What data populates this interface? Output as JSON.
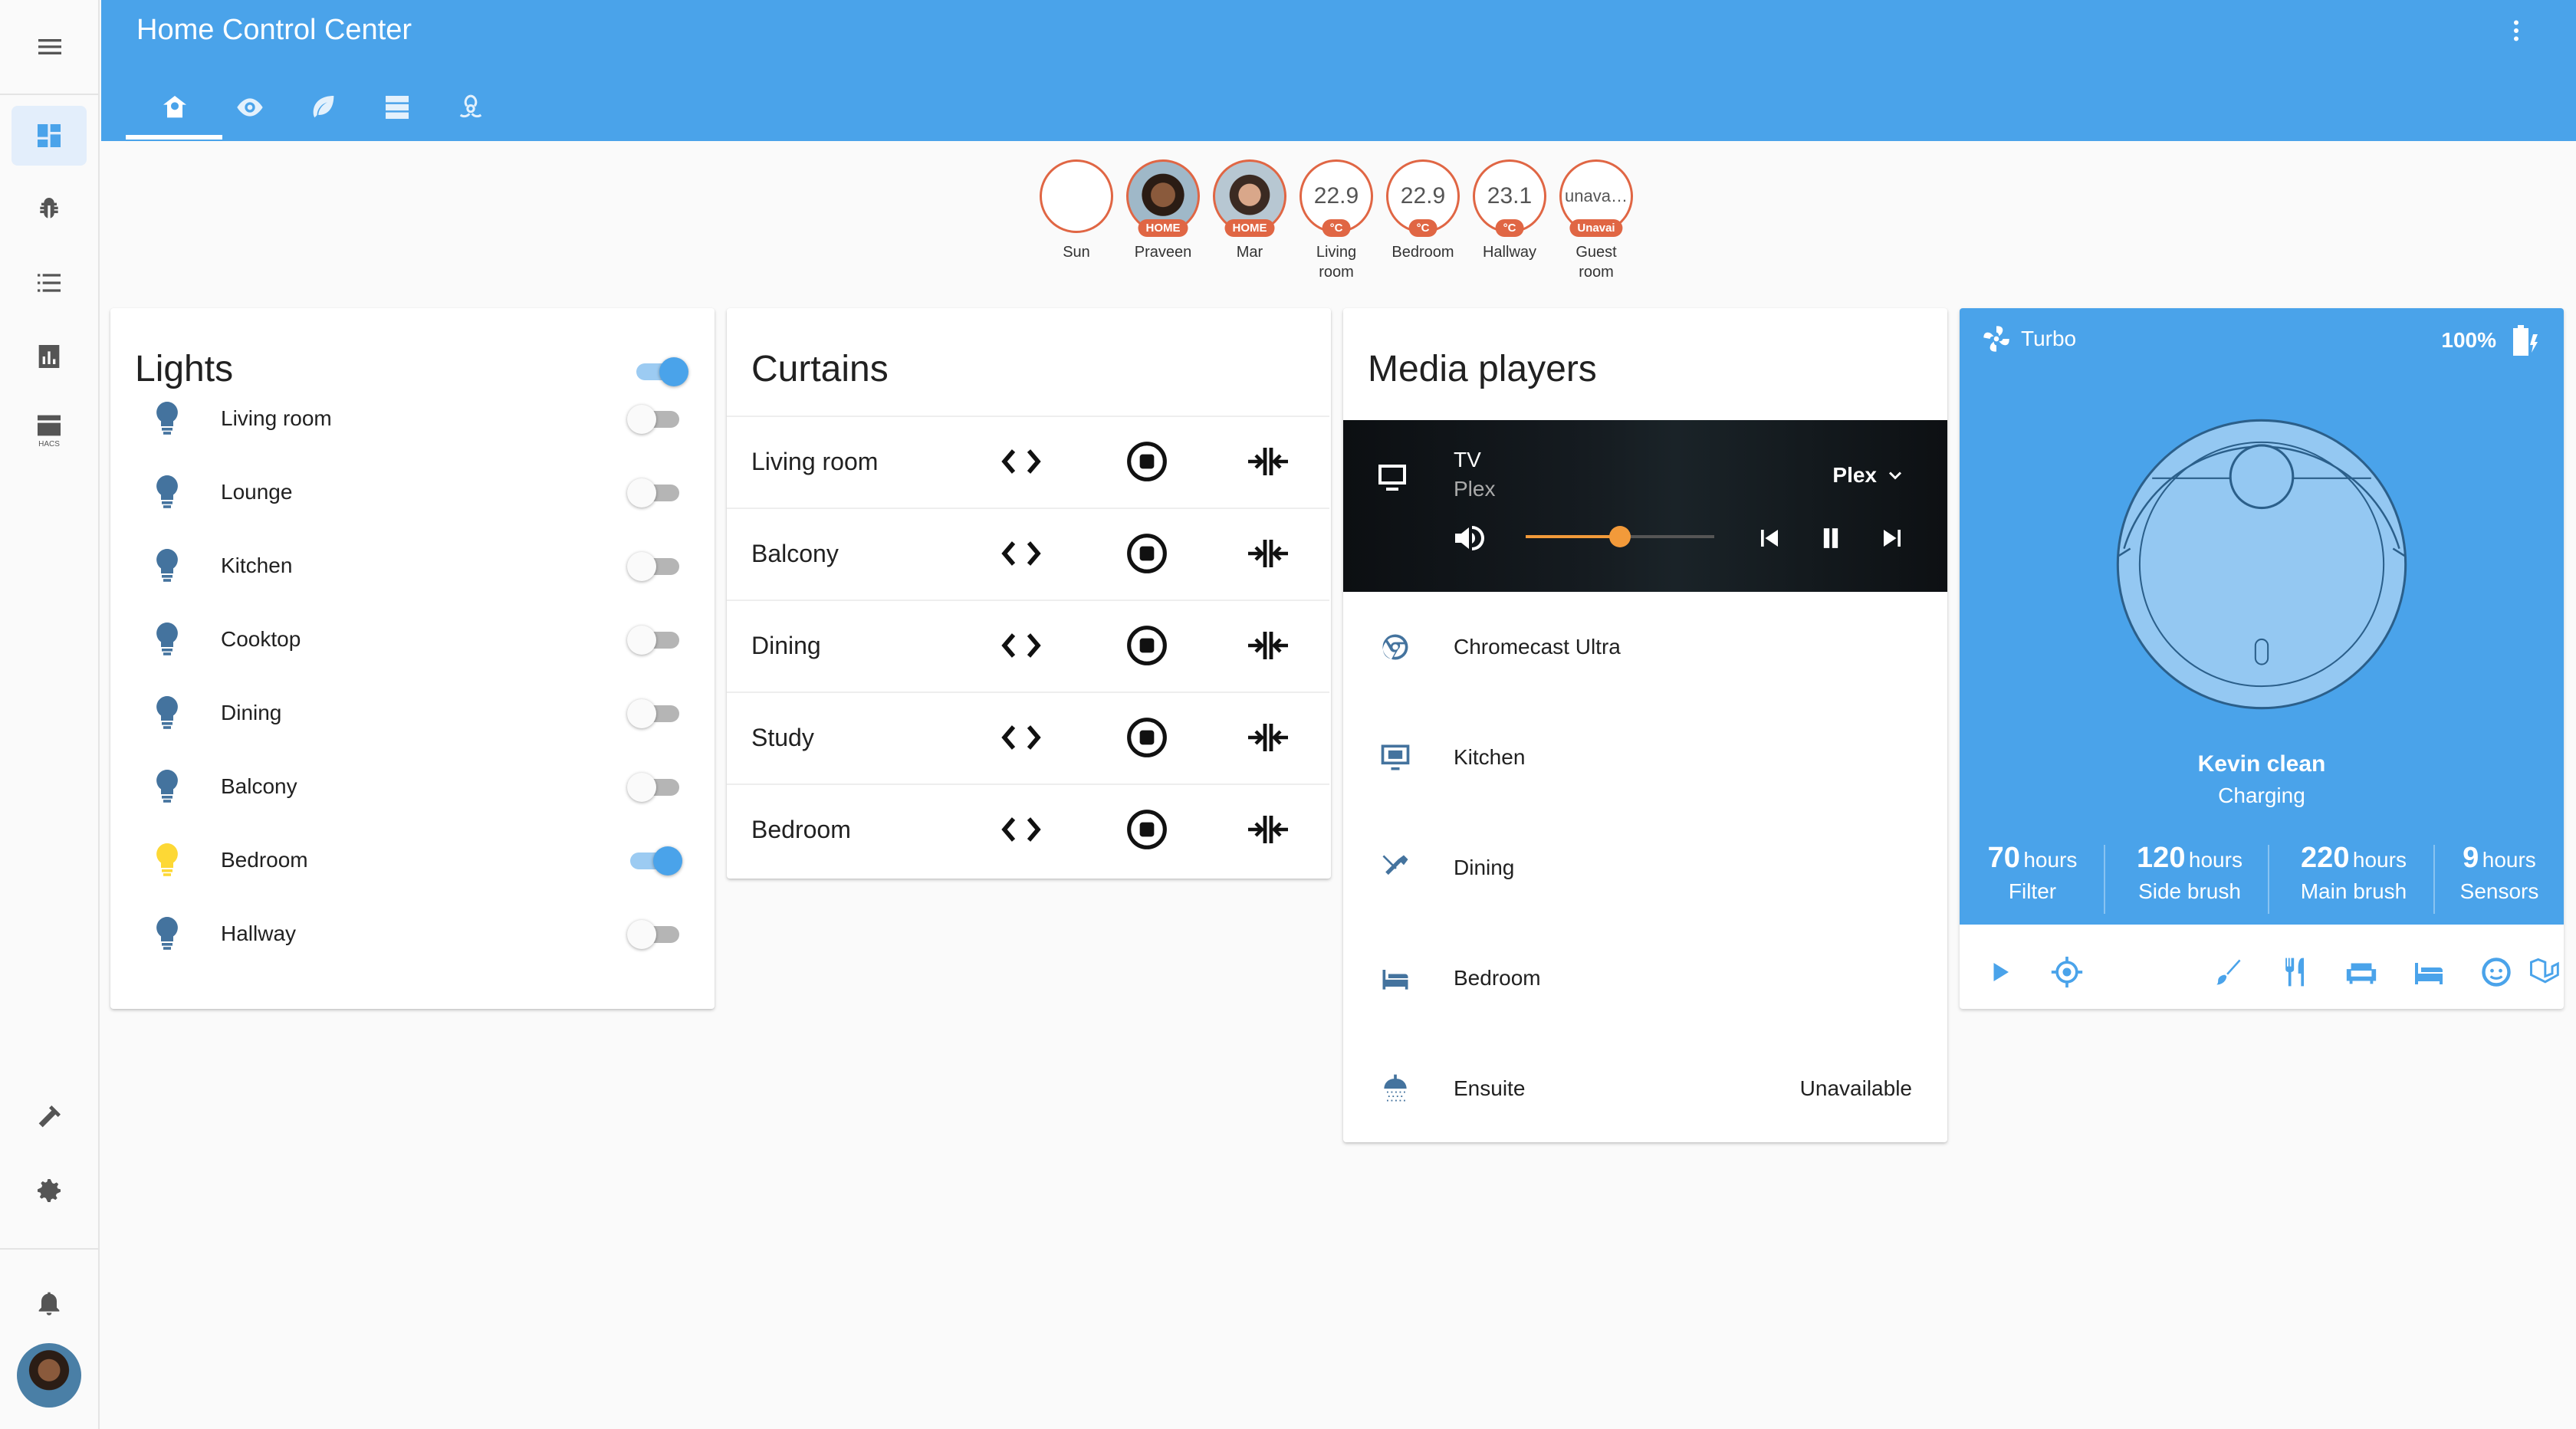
{
  "header": {
    "title": "Home Control Center"
  },
  "tabs": [
    {
      "name": "home-icon"
    },
    {
      "name": "eye-icon"
    },
    {
      "name": "leaf-icon"
    },
    {
      "name": "server-icon"
    },
    {
      "name": "biohazard-icon"
    }
  ],
  "sidebar": {
    "items": [
      {
        "name": "dashboard-icon"
      },
      {
        "name": "bug-icon"
      },
      {
        "name": "list-icon"
      },
      {
        "name": "chart-icon"
      },
      {
        "name": "hacs-icon",
        "label": "HACS"
      }
    ],
    "bottom": [
      {
        "name": "hammer-icon"
      },
      {
        "name": "gear-icon"
      },
      {
        "name": "bell-icon"
      }
    ]
  },
  "badges": [
    {
      "value": "",
      "tag": "",
      "label": "Sun"
    },
    {
      "value": "",
      "tag": "HOME",
      "label": "Praveen"
    },
    {
      "value": "",
      "tag": "HOME",
      "label": "Mar"
    },
    {
      "value": "22.9",
      "tag": "°C",
      "label": "Living room"
    },
    {
      "value": "22.9",
      "tag": "°C",
      "label": "Bedroom"
    },
    {
      "value": "23.1",
      "tag": "°C",
      "label": "Hallway"
    },
    {
      "value": "unava…",
      "tag": "Unavai",
      "label": "Guest room"
    }
  ],
  "lights": {
    "title": "Lights",
    "master_on": true,
    "items": [
      {
        "name": "Living room",
        "on": false
      },
      {
        "name": "Lounge",
        "on": false
      },
      {
        "name": "Kitchen",
        "on": false
      },
      {
        "name": "Cooktop",
        "on": false
      },
      {
        "name": "Dining",
        "on": false
      },
      {
        "name": "Balcony",
        "on": false
      },
      {
        "name": "Bedroom",
        "on": true
      },
      {
        "name": "Hallway",
        "on": false
      }
    ]
  },
  "curtains": {
    "title": "Curtains",
    "items": [
      "Living room",
      "Balcony",
      "Dining",
      "Study",
      "Bedroom"
    ]
  },
  "media": {
    "title": "Media players",
    "hero": {
      "name": "TV",
      "app": "Plex",
      "source": "Plex",
      "volume": 0.5
    },
    "players": [
      {
        "name": "Chromecast Ultra",
        "icon": "chromecast-icon",
        "state": ""
      },
      {
        "name": "Kitchen",
        "icon": "monitor-icon",
        "state": ""
      },
      {
        "name": "Dining",
        "icon": "utensils-icon",
        "state": ""
      },
      {
        "name": "Bedroom",
        "icon": "bed-icon",
        "state": ""
      },
      {
        "name": "Ensuite",
        "icon": "shower-icon",
        "state": "Unavailable"
      }
    ]
  },
  "vacuum": {
    "fan_mode": "Turbo",
    "battery": "100%",
    "name": "Kevin clean",
    "status": "Charging",
    "stats": [
      {
        "value": "70",
        "unit": "hours",
        "label": "Filter"
      },
      {
        "value": "120",
        "unit": "hours",
        "label": "Side brush"
      },
      {
        "value": "220",
        "unit": "hours",
        "label": "Main brush"
      },
      {
        "value": "9",
        "unit": "hours",
        "label": "Sensors"
      }
    ],
    "actions": [
      "play-icon",
      "locate-icon",
      "brush-icon",
      "utensils-icon",
      "sofa-icon",
      "bed-icon",
      "face-icon",
      "laravel-icon"
    ]
  },
  "colors": {
    "accent": "#4aa3ea",
    "badge": "#e06644",
    "light_on": "#fdd835",
    "light_off": "#44739e"
  }
}
